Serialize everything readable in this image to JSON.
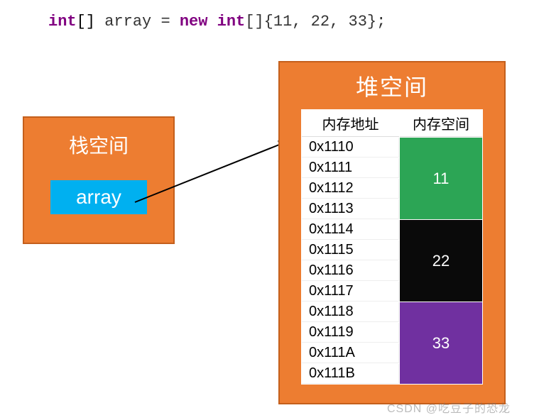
{
  "code": {
    "type_kw": "int",
    "brackets": "[]",
    "var": " array ",
    "eq": "= ",
    "new_kw": "new int",
    "init": "[]{11, 22, 33};"
  },
  "stack": {
    "title": "栈空间",
    "var_label": "array"
  },
  "heap": {
    "title": "堆空间",
    "headers": {
      "addr": "内存地址",
      "space": "内存空间"
    },
    "rows": [
      {
        "addr": "0x1110"
      },
      {
        "addr": "0x1111"
      },
      {
        "addr": "0x1112"
      },
      {
        "addr": "0x1113"
      },
      {
        "addr": "0x1114"
      },
      {
        "addr": "0x1115"
      },
      {
        "addr": "0x1116"
      },
      {
        "addr": "0x1117"
      },
      {
        "addr": "0x1118"
      },
      {
        "addr": "0x1119"
      },
      {
        "addr": "0x111A"
      },
      {
        "addr": "0x111B"
      }
    ],
    "values": [
      {
        "val": "11",
        "color": "green"
      },
      {
        "val": "22",
        "color": "black"
      },
      {
        "val": "33",
        "color": "purple"
      }
    ]
  },
  "watermark": "CSDN @吃豆子的恐龙",
  "chart_data": {
    "type": "table",
    "title": "堆空间",
    "columns": [
      "内存地址",
      "内存空间"
    ],
    "groups": [
      {
        "addresses": [
          "0x1110",
          "0x1111",
          "0x1112",
          "0x1113"
        ],
        "value": 11,
        "color": "#2ca555"
      },
      {
        "addresses": [
          "0x1114",
          "0x1115",
          "0x1116",
          "0x1117"
        ],
        "value": 22,
        "color": "#0a0a0a"
      },
      {
        "addresses": [
          "0x1118",
          "0x1119",
          "0x111A",
          "0x111B"
        ],
        "value": 33,
        "color": "#7030a0"
      }
    ],
    "stack_variable": "array",
    "declaration": "int[] array = new int[]{11, 22, 33};"
  }
}
